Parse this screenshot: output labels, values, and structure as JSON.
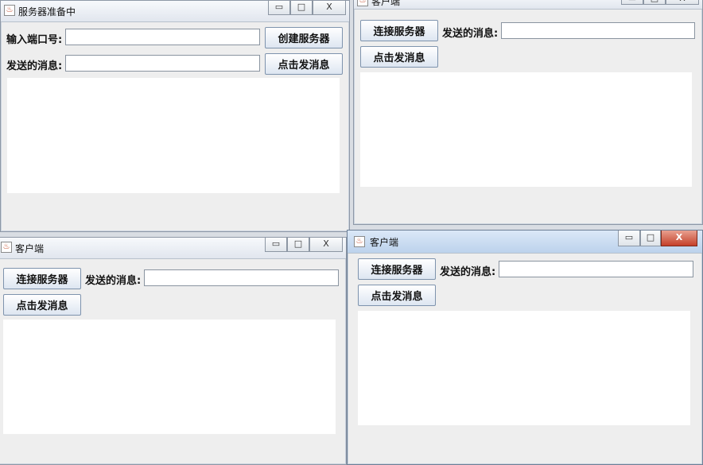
{
  "windows": {
    "server": {
      "title": "服务器准备中",
      "port_label": "输入端口号:",
      "port_value": "",
      "create_button": "创建服务器",
      "message_label": "发送的消息:",
      "message_value": "",
      "send_button": "点击发消息",
      "log_text": ""
    },
    "client_top_right": {
      "title": "客户端",
      "connect_button": "连接服务器",
      "message_label": "发送的消息:",
      "message_value": "",
      "send_button": "点击发消息",
      "log_text": ""
    },
    "client_bottom_left": {
      "title": "客户端",
      "connect_button": "连接服务器",
      "message_label": "发送的消息:",
      "message_value": "",
      "send_button": "点击发消息",
      "log_text": ""
    },
    "client_bottom_right": {
      "title": "客户端",
      "connect_button": "连接服务器",
      "message_label": "发送的消息:",
      "message_value": "",
      "send_button": "点击发消息",
      "log_text": ""
    }
  },
  "window_controls": {
    "minimize": "▭",
    "maximize": "□",
    "close": "X"
  },
  "icons": {
    "app": "java-cup-icon"
  }
}
